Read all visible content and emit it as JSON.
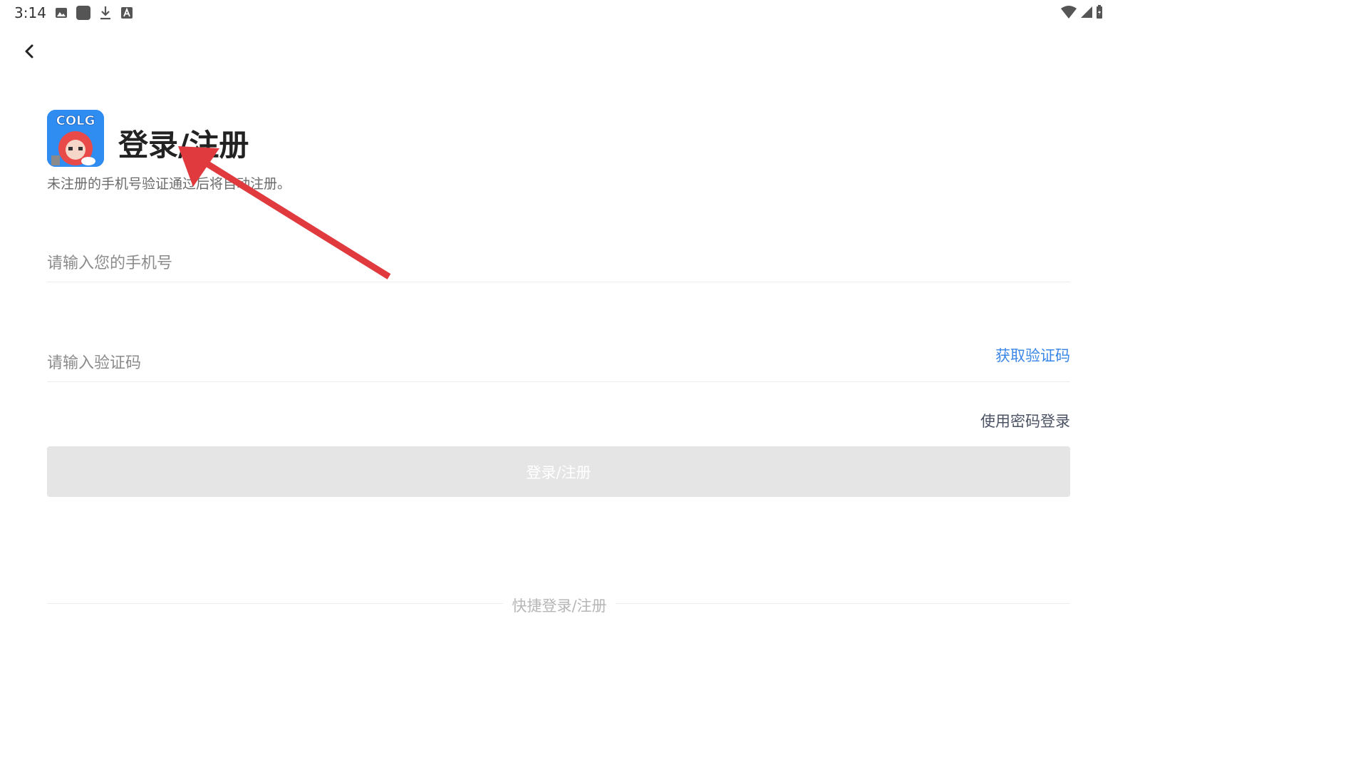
{
  "status_bar": {
    "time": "3:14",
    "left_icons": [
      "image-icon",
      "app-square-icon",
      "download-icon",
      "keyboard-a-icon"
    ],
    "right_icons": [
      "wifi-icon",
      "signal-icon",
      "battery-icon"
    ]
  },
  "header": {
    "back_icon": "chevron-left-icon",
    "logo_text": "COLG",
    "title": "登录/注册",
    "subtitle": "未注册的手机号验证通过后将自动注册。"
  },
  "form": {
    "phone_placeholder": "请输入您的手机号",
    "phone_value": "",
    "code_placeholder": "请输入验证码",
    "code_value": "",
    "get_code_label": "获取验证码",
    "password_login_label": "使用密码登录",
    "submit_label": "登录/注册"
  },
  "quick_login": {
    "label": "快捷登录/注册"
  },
  "colors": {
    "accent": "#3b87e8",
    "button_disabled": "#e5e5e5",
    "annotation": "#e0393e"
  }
}
